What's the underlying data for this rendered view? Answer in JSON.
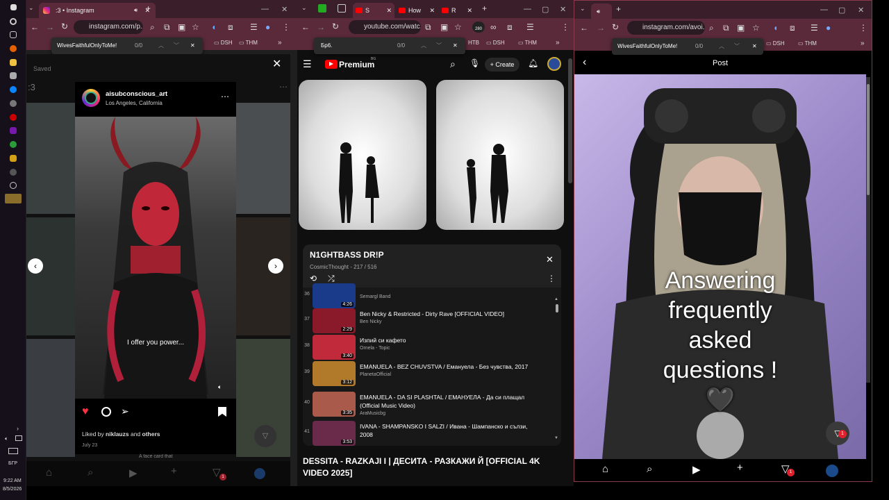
{
  "taskbar": {
    "lang": "БГР",
    "time": "9:22 AM",
    "date": "8/5/2026"
  },
  "left_window": {
    "tab_title": ":3 • Instagram",
    "url": "instagram.com/p...",
    "find_query": "WivesFaithfulOnlyToMe!",
    "find_count": "0/0",
    "bookmarks": [
      "DSH",
      "THM"
    ],
    "saved_label": "Saved",
    "page_title": ":3",
    "post": {
      "username": "aisubconscious_art",
      "location": "Los Angeles, California",
      "caption_overlay": "I offer you power...",
      "liked_by_prefix": "Liked by",
      "liked_by_user": "niklauzs",
      "liked_by_and": "and",
      "liked_by_others": "others",
      "date": "July 23"
    },
    "bg_caption": "A face card that",
    "notif_count": "1"
  },
  "middle_window": {
    "tab_titles": [
      "S",
      "How",
      "R"
    ],
    "url": "youtube.com/watc...",
    "find_query": "Бр6.",
    "find_count": "0/0",
    "bookmarks": [
      "HTB",
      "DSH",
      "THM"
    ],
    "badge": "280",
    "logo_text": "Premium",
    "logo_sup": "BG",
    "create_label": "+ Create",
    "playlist": {
      "title": "N1GHTBASS DR!P",
      "meta": "CosmicThought - 217 / 516",
      "items": [
        {
          "idx": "36",
          "title": "",
          "channel": "Semargl Band",
          "duration": "4:26"
        },
        {
          "idx": "37",
          "title": "Ben Nicky & Restricted - Dirty Rave [OFFICIAL VIDEO]",
          "channel": "Ben Nicky",
          "duration": "2:29"
        },
        {
          "idx": "38",
          "title": "Изпий си кафето",
          "channel": "Ornela - Topic",
          "duration": "3:40"
        },
        {
          "idx": "39",
          "title": "EMANUELA - BEZ CHUVSTVA / Емануела - Без чувства, 2017",
          "channel": "PlanetaOfficial",
          "duration": "3:12"
        },
        {
          "idx": "40",
          "title": "EMANUELA - DA SI PLASHTAL / ЕМАНУЕЛА - Да си плащал (Official Music Video)",
          "channel": "AraMusicbg",
          "duration": "3:35"
        },
        {
          "idx": "41",
          "title": "IVANA - SHAMPANSKO I SALZI / Ивана - Шампанско и сълзи, 2008",
          "channel": "",
          "duration": "3:53"
        }
      ]
    },
    "video_title": "DESSITA - RAZKAJI I | ДЕСИТА - РАЗКАЖИ Й [OFFICIAL 4K VIDEO 2025]"
  },
  "right_window": {
    "url": "instagram.com/avoi...",
    "find_query": "WivesFaithfulOnlyToMe!",
    "find_count": "0/0",
    "bookmarks": [
      "DSH",
      "THM"
    ],
    "header_title": "Post",
    "overlay_text": "Answering frequently asked questions ! 🖤",
    "notif_count": "1"
  },
  "colors": {
    "accent": "#ff3040",
    "yt_red": "#ff0000",
    "chrome_frame": "#5a2a3a"
  }
}
